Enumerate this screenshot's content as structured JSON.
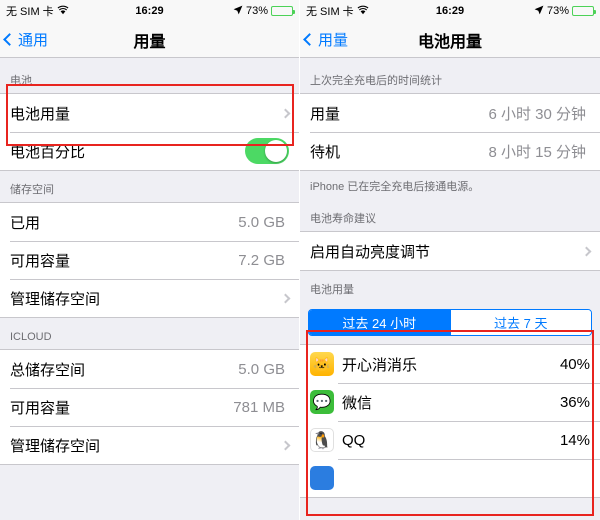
{
  "left": {
    "statusbar": {
      "carrier": "无 SIM 卡",
      "wifi_icon": "wifi-icon",
      "time": "16:29",
      "location_icon": "location-arrow-icon",
      "battery_percent": "73%",
      "battery_level": 73
    },
    "navbar": {
      "back_label": "通用",
      "title": "用量"
    },
    "sections": [
      {
        "header": "电池",
        "rows": [
          {
            "label": "电池用量",
            "value": "",
            "accessory": "chevron"
          },
          {
            "label": "电池百分比",
            "value": "",
            "accessory": "switch-on"
          }
        ]
      },
      {
        "header": "储存空间",
        "rows": [
          {
            "label": "已用",
            "value": "5.0 GB",
            "accessory": "none"
          },
          {
            "label": "可用容量",
            "value": "7.2 GB",
            "accessory": "none"
          },
          {
            "label": "管理储存空间",
            "value": "",
            "accessory": "chevron"
          }
        ]
      },
      {
        "header": "ICLOUD",
        "rows": [
          {
            "label": "总储存空间",
            "value": "5.0 GB",
            "accessory": "none"
          },
          {
            "label": "可用容量",
            "value": "781 MB",
            "accessory": "none"
          },
          {
            "label": "管理储存空间",
            "value": "",
            "accessory": "chevron"
          }
        ]
      }
    ]
  },
  "right": {
    "statusbar": {
      "carrier": "无 SIM 卡",
      "wifi_icon": "wifi-icon",
      "time": "16:29",
      "location_icon": "location-arrow-icon",
      "battery_percent": "73%",
      "battery_level": 73
    },
    "navbar": {
      "back_label": "用量",
      "title": "电池用量"
    },
    "time_section": {
      "header": "上次完全充电后的时间统计",
      "rows": [
        {
          "label": "用量",
          "value": "6 小时 30 分钟"
        },
        {
          "label": "待机",
          "value": "8 小时 15 分钟"
        }
      ],
      "footer": "iPhone 已在完全充电后接通电源。"
    },
    "advice_section": {
      "header": "电池寿命建议",
      "rows": [
        {
          "label": "启用自动亮度调节",
          "accessory": "chevron"
        }
      ]
    },
    "usage_section": {
      "header": "电池用量",
      "segments": [
        {
          "label": "过去 24 小时",
          "active": true
        },
        {
          "label": "过去 7 天",
          "active": false
        }
      ],
      "apps": [
        {
          "name": "开心消消乐",
          "percent": "40%",
          "icon": "happy-game-icon",
          "glyph": "🐱"
        },
        {
          "name": "微信",
          "percent": "36%",
          "icon": "wechat-icon",
          "glyph": "💬"
        },
        {
          "name": "QQ",
          "percent": "14%",
          "icon": "qq-icon",
          "glyph": "🐧"
        }
      ]
    }
  },
  "colors": {
    "highlight": "#e8241f",
    "accent": "#007aff",
    "switch_on": "#4cd964",
    "battery_green": "#4cd257"
  }
}
